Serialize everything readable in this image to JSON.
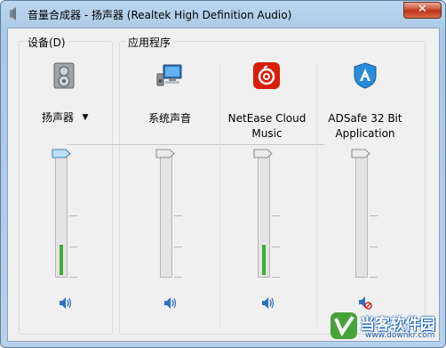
{
  "window": {
    "title": "音量合成器 - 扬声器 (Realtek High Definition Audio)",
    "close_label": "✕"
  },
  "devices": {
    "group_label": "设备(D)",
    "name": "扬声器",
    "dropdown_arrow": "▼",
    "volume_fraction": 0.25,
    "icon": "speaker-device-icon",
    "mute_icon": "speaker-icon"
  },
  "applications": {
    "group_label": "应用程序",
    "items": [
      {
        "name": "系统声音",
        "icon": "system-sounds-icon",
        "volume_fraction": 0.0,
        "muted": false
      },
      {
        "name": "NetEase Cloud Music",
        "icon": "netease-cloud-music-icon",
        "volume_fraction": 0.25,
        "muted": false
      },
      {
        "name": "ADSafe 32 Bit Application",
        "icon": "adsafe-icon",
        "volume_fraction": 0.0,
        "muted": true
      }
    ]
  },
  "colors": {
    "level_green": "#3aae3a",
    "mute_red": "#d9201c",
    "netease_red": "#d81e06",
    "adsafe_blue": "#2a8bd8"
  },
  "watermark": {
    "title": "当客软件园",
    "url": "www.downkr.com",
    "icon": "downkr-logo-icon"
  }
}
